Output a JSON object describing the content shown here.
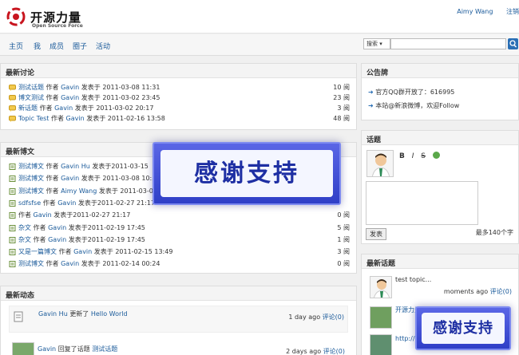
{
  "header": {
    "logo_title": "开源力量",
    "logo_sub": "Open Source Force",
    "user_name": "Aimy Wang",
    "user_link2": "注销"
  },
  "nav": {
    "items": [
      "主页",
      "我",
      "成员",
      "圈子",
      "活动"
    ]
  },
  "search": {
    "type_label": "搜索 ▾"
  },
  "discussions": {
    "title": "最新讨论",
    "rows": [
      {
        "topic": "测试话题",
        "pre": "作者",
        "author": "Gavin",
        "post": "发表于 2011-03-08 11:31",
        "count": "10 阅"
      },
      {
        "topic": "博文测试",
        "pre": "作者",
        "author": "Gavin",
        "post": "发表于 2011-03-02 23:45",
        "count": "23 阅"
      },
      {
        "topic": "新话题",
        "pre": "作者",
        "author": "Gavin",
        "post": "发表于 2011-03-02 20:17",
        "count": "3 阅"
      },
      {
        "topic": "Topic Test",
        "pre": "作者",
        "author": "Gavin",
        "post": "发表于 2011-02-16 13:58",
        "count": "48 阅"
      }
    ]
  },
  "blogs": {
    "title": "最新博文",
    "rows": [
      {
        "topic": "测试博文",
        "pre": "作者",
        "author": "Gavin Hu",
        "post": "发表于2011-03-15",
        "count": ""
      },
      {
        "topic": "测试博文",
        "pre": "作者",
        "author": "Gavin",
        "post": "发表于 2011-03-08 10:5",
        "count": ""
      },
      {
        "topic": "测试博文",
        "pre": "作者",
        "author": "Aimy Wang",
        "post": "发表于 2011-03-0",
        "count": ""
      },
      {
        "topic": "sdfsfse",
        "pre": "作者",
        "author": "Gavin",
        "post": "发表于2011-02-27 21:17",
        "count": ""
      },
      {
        "topic": "",
        "pre": "作者",
        "author": "Gavin",
        "post": "发表于2011-02-27 21:17",
        "count": "0 阅"
      },
      {
        "topic": "杂文",
        "pre": "作者",
        "author": "Gavin",
        "post": "发表于2011-02-19 17:45",
        "count": "5 阅"
      },
      {
        "topic": "杂文",
        "pre": "作者",
        "author": "Gavin",
        "post": "发表于2011-02-19 17:45",
        "count": "1 阅"
      },
      {
        "topic": "又是一篇博文",
        "pre": "作者",
        "author": "Gavin",
        "post": "发表于 2011-02-15 13:49",
        "count": "3 阅"
      },
      {
        "topic": "测试博文",
        "pre": "作者",
        "author": "Gavin",
        "post": "发表于 2011-02-14 00:24",
        "count": "0 阅"
      }
    ]
  },
  "activity": {
    "title": "最新动态",
    "items": [
      {
        "actor": "Gavin Hu",
        "verb": "更新了",
        "target": "Hello World",
        "time": "1 day ago",
        "comment": "评论(0)"
      },
      {
        "actor": "Gavin",
        "verb": "回复了话题",
        "target": "测试话题",
        "time": "2 days ago",
        "comment": "评论(0)"
      }
    ]
  },
  "notice": {
    "title": "公告牌",
    "items": [
      "官方QQ群开放了：616995",
      "本站@新浪微博，欢迎Follow"
    ]
  },
  "topic_box": {
    "title": "话题",
    "tools": [
      "B",
      "I",
      "S"
    ],
    "submit": "发表",
    "limit": "最多140个字"
  },
  "latest_topics": {
    "title": "最新话题",
    "items": [
      {
        "text": "test topic...",
        "time": "moments ago",
        "comment": "评论(0)"
      },
      {
        "text": "开源力量",
        "time": "",
        "comment": ""
      },
      {
        "text": "http://v",
        "time": "",
        "comment": ""
      }
    ]
  },
  "promo": {
    "big": "感谢支持",
    "small": "感谢支持"
  },
  "colors": {
    "link": "#1a5a9a",
    "brand_red": "#c8141e",
    "promo_blue": "#2f3fc7"
  }
}
